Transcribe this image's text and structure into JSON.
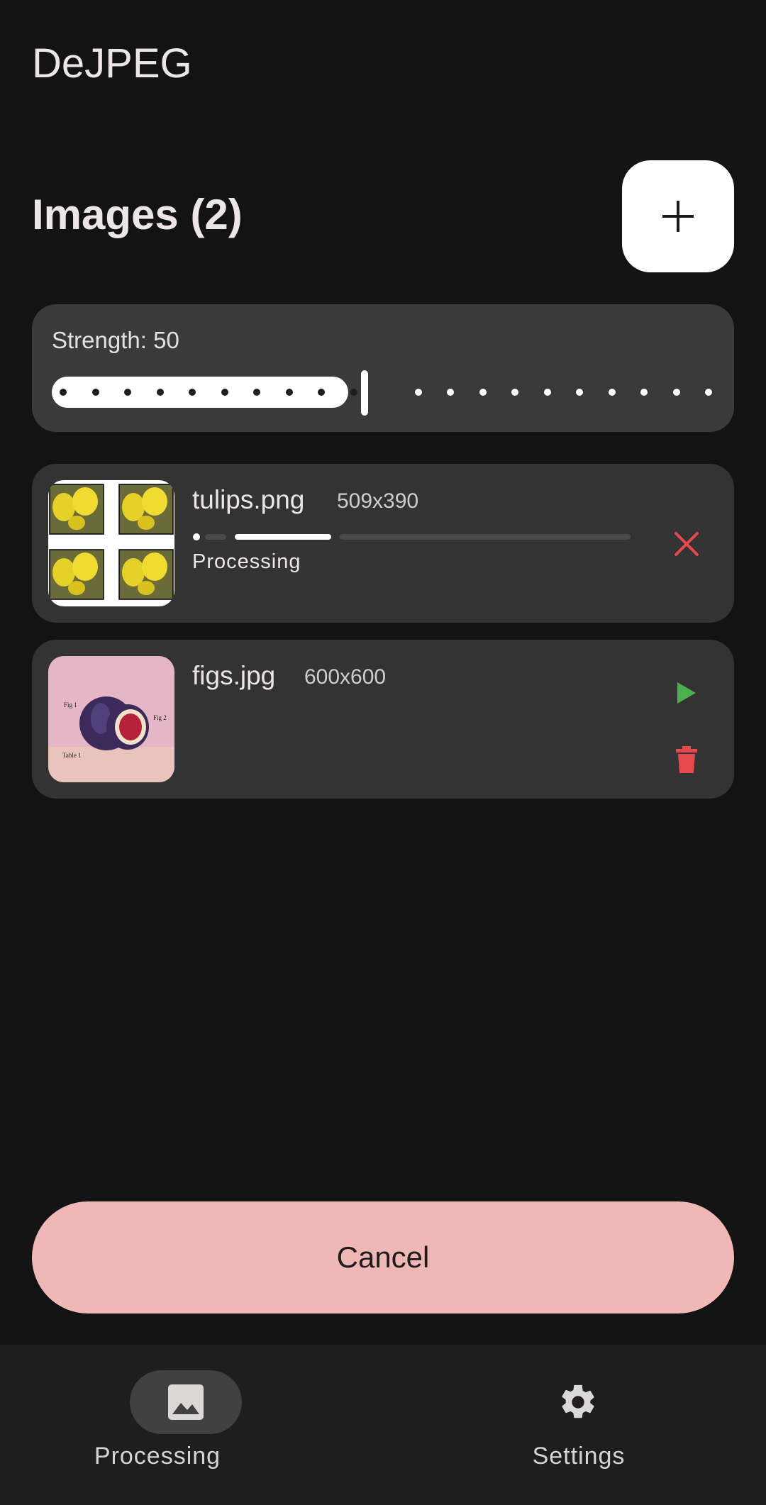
{
  "app": {
    "title": "DeJPEG"
  },
  "images_section": {
    "title": "Images (2)",
    "add_icon": "plus-icon"
  },
  "strength": {
    "label": "Strength: 50",
    "value": 50,
    "min": 0,
    "max": 100,
    "steps": 20
  },
  "items": [
    {
      "filename": "tulips.png",
      "dimensions": "509x390",
      "status": "Processing",
      "progress": 0.25,
      "action_icon": "close-icon",
      "action_color": "#e5484d"
    },
    {
      "filename": "figs.jpg",
      "dimensions": "600x600",
      "play_icon": "play-icon",
      "play_color": "#4caf50",
      "delete_icon": "trash-icon",
      "delete_color": "#e5484d"
    }
  ],
  "cancel_button": {
    "label": "Cancel",
    "color": "#efb7b5"
  },
  "nav": {
    "items": [
      {
        "label": "Processing",
        "icon": "image-icon",
        "active": true
      },
      {
        "label": "Settings",
        "icon": "gear-icon",
        "active": false
      }
    ]
  }
}
